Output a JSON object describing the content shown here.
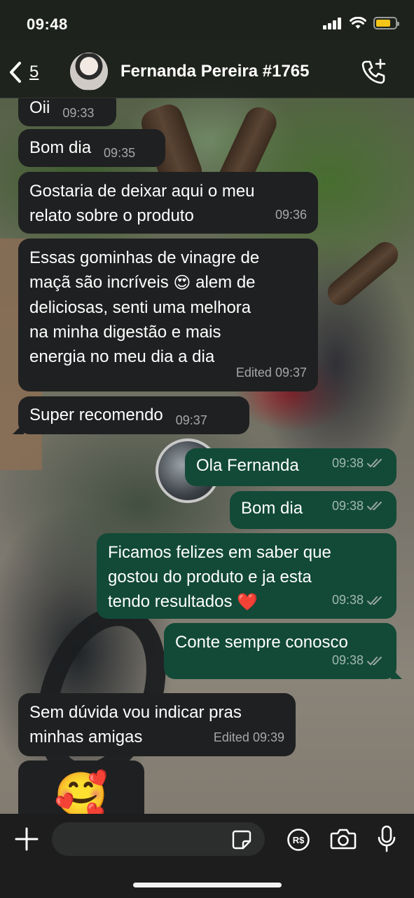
{
  "status": {
    "time": "09:48",
    "battery_percent": 0.75
  },
  "header": {
    "back_count": "5",
    "contact_name": "Fernanda Pereira #1765"
  },
  "icons": {
    "back": "chevron-left-icon",
    "call": "phone-plus-icon",
    "add": "plus-icon",
    "sticker": "sticker-icon",
    "payment": "pix-rs-icon",
    "camera": "camera-icon",
    "mic": "microphone-icon"
  },
  "colors": {
    "incoming_bubble": "#1f2021",
    "outgoing_bubble": "#124a37",
    "battery": "#f5c518",
    "read_ticks": "#9aa6a1"
  },
  "messages": [
    {
      "direction": "in",
      "lines": [
        "Oii"
      ],
      "time": "09:33"
    },
    {
      "direction": "in",
      "lines": [
        "Bom dia"
      ],
      "time": "09:35"
    },
    {
      "direction": "in",
      "lines": [
        "Gostaria de deixar aqui o meu",
        "relato sobre o produto"
      ],
      "time": "09:36"
    },
    {
      "direction": "in",
      "lines": [
        "Essas gominhas de vinagre de",
        "maçã são incríveis",
        "alem de",
        "deliciosas, senti uma melhora",
        "na minha digestão e mais",
        "energia no meu dia a dia"
      ],
      "time": "Edited 09:37",
      "emoji": "😍"
    },
    {
      "direction": "in",
      "lines": [
        "Super recomendo"
      ],
      "time": "09:37"
    },
    {
      "direction": "out",
      "lines": [
        "Ola Fernanda"
      ],
      "time": "09:38"
    },
    {
      "direction": "out",
      "lines": [
        "Bom dia"
      ],
      "time": "09:38"
    },
    {
      "direction": "out",
      "lines": [
        "Ficamos felizes em saber que",
        "gostou do produto e ja esta",
        "tendo resultados"
      ],
      "time": "09:38",
      "emoji": "❤️"
    },
    {
      "direction": "out",
      "lines": [
        "Conte sempre conosco"
      ],
      "time": "09:38"
    },
    {
      "direction": "in",
      "lines": [
        "Sem dúvida vou indicar pras",
        "minhas amigas"
      ],
      "time": "Edited 09:39"
    },
    {
      "direction": "in",
      "emoji_only": "🥰"
    }
  ],
  "composer": {
    "placeholder": ""
  }
}
